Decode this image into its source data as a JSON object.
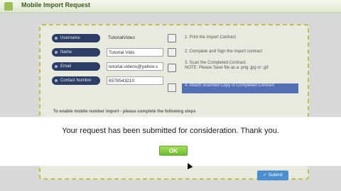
{
  "header": {
    "title": "Mobile Import Request"
  },
  "form": {
    "fields": [
      {
        "label": "Username",
        "value": "TutorialVideo"
      },
      {
        "label": "Name",
        "value": "Tutorial Vido"
      },
      {
        "label": "Email",
        "value": "tutorial.videos@yahoo.c"
      },
      {
        "label": "Contact Number",
        "value": "6578543210"
      }
    ],
    "steps": [
      {
        "text": "1. Print the Import Contract"
      },
      {
        "text": "2. Complete and Sign the import contract"
      },
      {
        "text": "3. Scan the Completed Contract."
      },
      {
        "note": "NOTE: Please Save file as a .png .jpg or .gif"
      },
      {
        "text": "4. Attach Scanned Copy of Completed Contract"
      }
    ],
    "instructions": "To enable mobile number import - please complete the following steps",
    "submit_label": "Submit",
    "submit_icon": "checkmark-icon"
  },
  "modal": {
    "message": "Your request has been submitted for consideration. Thank you.",
    "ok_label": "OK"
  },
  "colors": {
    "accent_green": "#7fc83a",
    "label_navy": "#2c3d66",
    "highlight_blue": "#5370b7",
    "submit_blue": "#4c8fd1"
  }
}
